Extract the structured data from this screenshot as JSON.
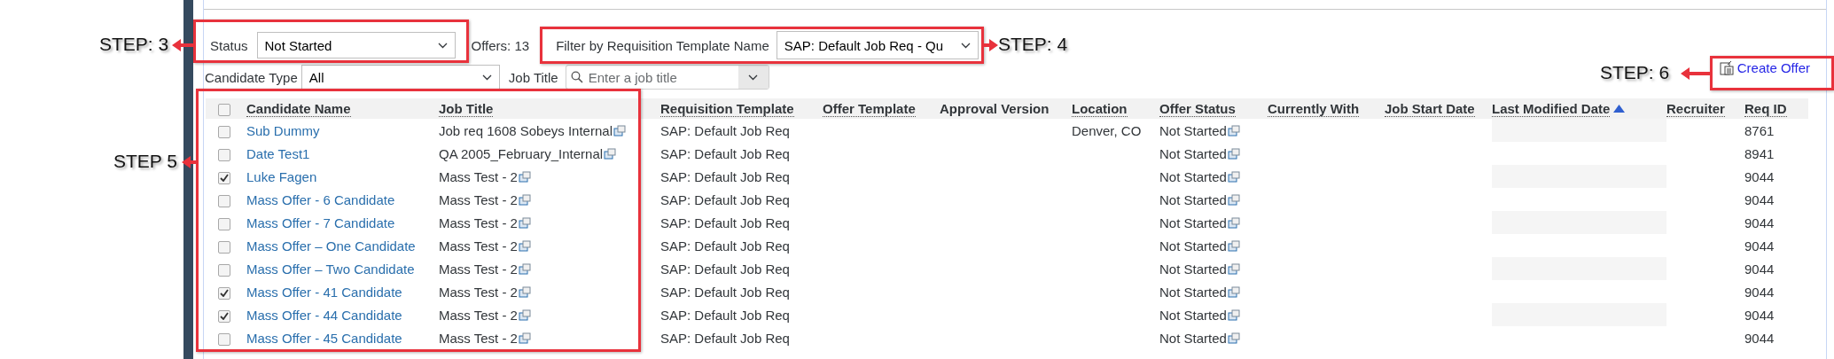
{
  "filters": {
    "status": {
      "label": "Status",
      "value": "Not Started"
    },
    "offers_count": "Offers: 13",
    "template_filter": {
      "label": "Filter by Requisition Template Name",
      "value": "SAP: Default Job Req - Qu"
    },
    "candidate_type": {
      "label": "Candidate Type",
      "value": "All"
    },
    "job_title": {
      "label": "Job Title",
      "placeholder": "Enter a job title"
    }
  },
  "create_offer": "Create Offer",
  "table": {
    "all_selected": false,
    "columns": [
      {
        "label": "Candidate Name",
        "sortable": true,
        "sorted": false
      },
      {
        "label": "Job Title",
        "sortable": true,
        "sorted": false
      },
      {
        "label": "Requisition Template",
        "sortable": true,
        "sorted": false
      },
      {
        "label": "Offer Template",
        "sortable": true,
        "sorted": false
      },
      {
        "label": "Approval Version",
        "sortable": false,
        "sorted": false
      },
      {
        "label": "Location",
        "sortable": true,
        "sorted": false
      },
      {
        "label": "Offer Status",
        "sortable": true,
        "sorted": false
      },
      {
        "label": "Currently With",
        "sortable": true,
        "sorted": false
      },
      {
        "label": "Job Start Date",
        "sortable": true,
        "sorted": false
      },
      {
        "label": "Last Modified Date",
        "sortable": true,
        "sorted": true
      },
      {
        "label": "Recruiter",
        "sortable": true,
        "sorted": false
      },
      {
        "label": "Req ID",
        "sortable": true,
        "sorted": false
      }
    ],
    "rows": [
      {
        "selected": false,
        "candidate": "Sub Dummy",
        "job_title": "Job req 1608 Sobeys Internal",
        "requisition_template": "SAP: Default Job Req",
        "location": "Denver, CO",
        "offer_status": "Not Started",
        "req_id": "8761"
      },
      {
        "selected": false,
        "candidate": "Date Test1",
        "job_title": "QA 2005_February_Internal",
        "requisition_template": "SAP: Default Job Req",
        "offer_status": "Not Started",
        "req_id": "8941"
      },
      {
        "selected": true,
        "candidate": "Luke Fagen",
        "job_title": "Mass Test - 2",
        "requisition_template": "SAP: Default Job Req",
        "offer_status": "Not Started",
        "req_id": "9044"
      },
      {
        "selected": false,
        "candidate": "Mass Offer - 6 Candidate",
        "job_title": "Mass Test - 2",
        "requisition_template": "SAP: Default Job Req",
        "offer_status": "Not Started",
        "req_id": "9044"
      },
      {
        "selected": false,
        "candidate": "Mass Offer - 7 Candidate",
        "job_title": "Mass Test - 2",
        "requisition_template": "SAP: Default Job Req",
        "offer_status": "Not Started",
        "req_id": "9044"
      },
      {
        "selected": false,
        "candidate": "Mass Offer – One Candidate",
        "job_title": "Mass Test - 2",
        "requisition_template": "SAP: Default Job Req",
        "offer_status": "Not Started",
        "req_id": "9044"
      },
      {
        "selected": false,
        "candidate": "Mass Offer – Two Candidate",
        "job_title": "Mass Test - 2",
        "requisition_template": "SAP: Default Job Req",
        "offer_status": "Not Started",
        "req_id": "9044"
      },
      {
        "selected": true,
        "candidate": "Mass Offer - 41 Candidate",
        "job_title": "Mass Test - 2",
        "requisition_template": "SAP: Default Job Req",
        "offer_status": "Not Started",
        "req_id": "9044"
      },
      {
        "selected": true,
        "candidate": "Mass Offer - 44 Candidate",
        "job_title": "Mass Test - 2",
        "requisition_template": "SAP: Default Job Req",
        "offer_status": "Not Started",
        "req_id": "9044"
      },
      {
        "selected": false,
        "candidate": "Mass Offer - 45 Candidate",
        "job_title": "Mass Test - 2",
        "requisition_template": "SAP: Default Job Req",
        "offer_status": "Not Started",
        "req_id": "9044"
      }
    ]
  },
  "annotations": [
    {
      "label": "STEP: 3"
    },
    {
      "label": "STEP: 4"
    },
    {
      "label": "STEP 5"
    },
    {
      "label": "STEP: 6"
    }
  ]
}
